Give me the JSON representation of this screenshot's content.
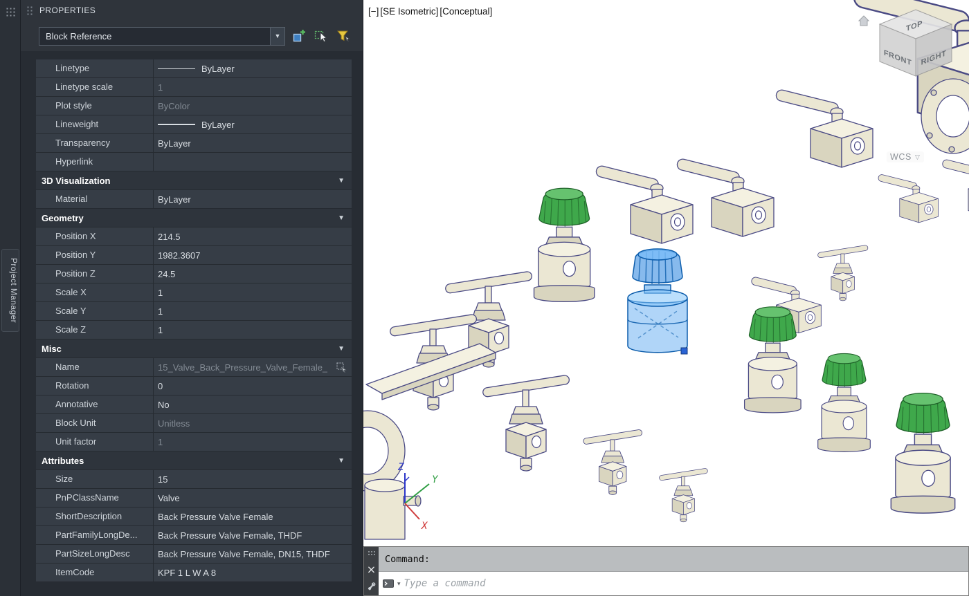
{
  "left_rail": {
    "tab_label": "Project Manager"
  },
  "properties_panel": {
    "title": "PROPERTIES",
    "type_selector": {
      "value": "Block Reference"
    },
    "toolbar_icons": [
      "toggle-pickadd",
      "select-objects",
      "quick-select"
    ],
    "sections": [
      {
        "title": "",
        "rows": [
          {
            "label": "Linetype",
            "value": "ByLayer",
            "swatch": "line"
          },
          {
            "label": "Linetype scale",
            "value": "1",
            "muted": true
          },
          {
            "label": "Plot style",
            "value": "ByColor",
            "muted": true
          },
          {
            "label": "Lineweight",
            "value": "ByLayer",
            "swatch": "line-thick"
          },
          {
            "label": "Transparency",
            "value": "ByLayer"
          },
          {
            "label": "Hyperlink",
            "value": ""
          }
        ]
      },
      {
        "title": "3D Visualization",
        "rows": [
          {
            "label": "Material",
            "value": "ByLayer"
          }
        ]
      },
      {
        "title": "Geometry",
        "rows": [
          {
            "label": "Position X",
            "value": "214.5"
          },
          {
            "label": "Position Y",
            "value": "1982.3607"
          },
          {
            "label": "Position Z",
            "value": "24.5"
          },
          {
            "label": "Scale X",
            "value": "1"
          },
          {
            "label": "Scale Y",
            "value": "1"
          },
          {
            "label": "Scale Z",
            "value": "1"
          }
        ]
      },
      {
        "title": "Misc",
        "rows": [
          {
            "label": "Name",
            "value": "15_Valve_Back_Pressure_Valve_Female_",
            "muted": true,
            "trailing_icon": "name-pick"
          },
          {
            "label": "Rotation",
            "value": "0"
          },
          {
            "label": "Annotative",
            "value": "No"
          },
          {
            "label": "Block Unit",
            "value": "Unitless",
            "muted": true
          },
          {
            "label": "Unit factor",
            "value": "1",
            "muted": true
          }
        ]
      },
      {
        "title": "Attributes",
        "rows": [
          {
            "label": "Size",
            "value": "15"
          },
          {
            "label": "PnPClassName",
            "value": "Valve"
          },
          {
            "label": "ShortDescription",
            "value": "Back Pressure Valve Female"
          },
          {
            "label": "PartFamilyLongDe...",
            "value": "Back Pressure Valve Female, THDF"
          },
          {
            "label": "PartSizeLongDesc",
            "value": "Back Pressure Valve Female, DN15, THDF"
          },
          {
            "label": "ItemCode",
            "value": "KPF 1 L W A 8"
          }
        ]
      }
    ]
  },
  "viewport": {
    "controls": {
      "menu": "[−]",
      "view": "[SE Isometric]",
      "visual_style": "[Conceptual]"
    },
    "viewcube": {
      "top": "TOP",
      "front": "FRONT",
      "right": "RIGHT",
      "wcs": "WCS"
    },
    "ucs": {
      "x": "X",
      "y": "Y",
      "z": "Z"
    }
  },
  "command_line": {
    "history_text": "Command:",
    "input_placeholder": "Type a command"
  },
  "colors": {
    "selection_blue": "#1e7fd8",
    "model_cream": "#ebe7d3",
    "model_edge": "#4a4a84",
    "knob_green": "#3fa84b",
    "viewport_bg": "#ffffff",
    "panel_bg": "#2f343b"
  }
}
